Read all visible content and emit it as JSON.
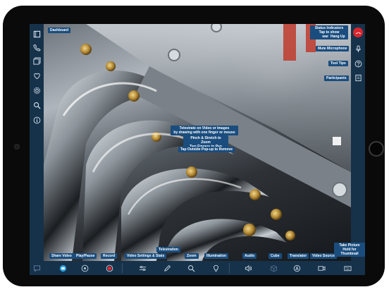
{
  "colors": {
    "bezel": "#0a0a0a",
    "sidebar": "#16324a",
    "tooltip": "#1a4d7e",
    "hang_up": "#d9262f",
    "record": "#e5262f",
    "share_video": "#2aa4e6"
  },
  "left_sidebar": {
    "icons": [
      "square-icon",
      "phone-icon",
      "gallery-icon",
      "heart-icon",
      "gear-icon",
      "search-icon",
      "info-icon"
    ]
  },
  "right_sidebar": {
    "icons": [
      "hang-up-icon",
      "microphone-icon",
      "help-icon",
      "participants-icon"
    ]
  },
  "tooltips": {
    "dashboard": "Dashboard",
    "status_indicators_line1": "Status Indicators",
    "status_indicators_line2": "Tap to show warning",
    "hang_up": "Hang Up",
    "mute_microphone": "Mute Microphone",
    "tool_tips": "Tool Tips",
    "participants": "Participants",
    "telestrate_line1": "Telestrate on Video or Images",
    "telestrate_line2": "by drawing with one finger or mouse",
    "pinch_line1": "Pinch & Stretch to Zoom",
    "pinch_line2": "Two Fingers to Pan",
    "tap_outside": "Tap Outside Pop-up to Remove",
    "share_video": "Share Video",
    "play_pause": "Play/Pause",
    "record": "Record",
    "video_settings": "Video Settings & Stats",
    "telestration": "Telestration",
    "zoom": "Zoom",
    "illumination": "Illumination",
    "audio": "Audio",
    "cube": "Cube",
    "translator": "Translator",
    "video_source": "Video Source",
    "take_picture_line1": "Take Picture",
    "take_picture_line2": "Hold for Thumbnail"
  },
  "bottom_bar": {
    "icons": [
      "chat-icon",
      "share-video-icon",
      "play-pause-icon",
      "record-icon",
      "settings-sliders-icon",
      "pencil-icon",
      "zoom-icon",
      "bulb-icon",
      "speaker-icon",
      "cube-icon",
      "translator-icon",
      "video-camera-icon",
      "keyboard-icon"
    ]
  }
}
